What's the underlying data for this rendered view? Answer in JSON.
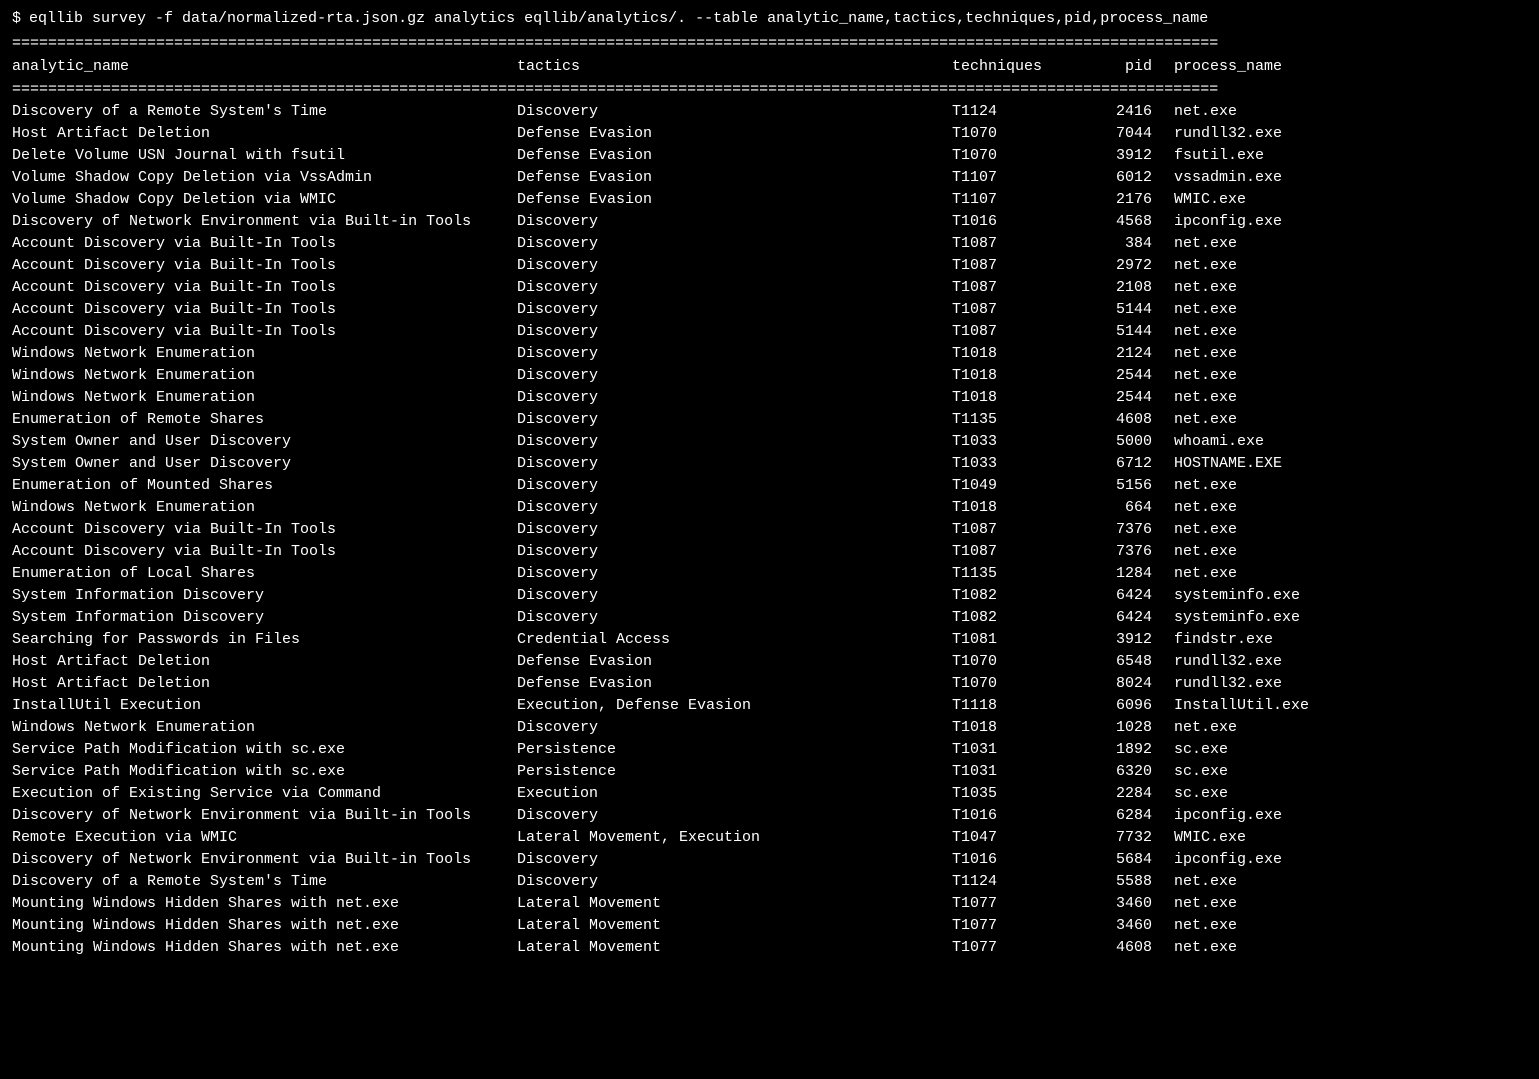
{
  "prompt": "$",
  "command": "eqllib survey -f data/normalized-rta.json.gz analytics eqllib/analytics/. --table analytic_name,tactics,techniques,pid,process_name",
  "divider": "======================================================================================================================================",
  "headers": {
    "analytic_name": "analytic_name",
    "tactics": "tactics",
    "techniques": "techniques",
    "pid": "pid",
    "process_name": "process_name"
  },
  "rows": [
    {
      "analytic_name": "Discovery of a Remote System's Time",
      "tactics": "Discovery",
      "techniques": "T1124",
      "pid": "2416",
      "process_name": "net.exe"
    },
    {
      "analytic_name": "Host Artifact Deletion",
      "tactics": "Defense Evasion",
      "techniques": "T1070",
      "pid": "7044",
      "process_name": "rundll32.exe"
    },
    {
      "analytic_name": "Delete Volume USN Journal with fsutil",
      "tactics": "Defense Evasion",
      "techniques": "T1070",
      "pid": "3912",
      "process_name": "fsutil.exe"
    },
    {
      "analytic_name": "Volume Shadow Copy Deletion via VssAdmin",
      "tactics": "Defense Evasion",
      "techniques": "T1107",
      "pid": "6012",
      "process_name": "vssadmin.exe"
    },
    {
      "analytic_name": "Volume Shadow Copy Deletion via WMIC",
      "tactics": "Defense Evasion",
      "techniques": "T1107",
      "pid": "2176",
      "process_name": "WMIC.exe"
    },
    {
      "analytic_name": "Discovery of Network Environment via Built-in Tools",
      "tactics": "Discovery",
      "techniques": "T1016",
      "pid": "4568",
      "process_name": "ipconfig.exe"
    },
    {
      "analytic_name": "Account Discovery via Built-In Tools",
      "tactics": "Discovery",
      "techniques": "T1087",
      "pid": "384",
      "process_name": "net.exe"
    },
    {
      "analytic_name": "Account Discovery via Built-In Tools",
      "tactics": "Discovery",
      "techniques": "T1087",
      "pid": "2972",
      "process_name": "net.exe"
    },
    {
      "analytic_name": "Account Discovery via Built-In Tools",
      "tactics": "Discovery",
      "techniques": "T1087",
      "pid": "2108",
      "process_name": "net.exe"
    },
    {
      "analytic_name": "Account Discovery via Built-In Tools",
      "tactics": "Discovery",
      "techniques": "T1087",
      "pid": "5144",
      "process_name": "net.exe"
    },
    {
      "analytic_name": "Account Discovery via Built-In Tools",
      "tactics": "Discovery",
      "techniques": "T1087",
      "pid": "5144",
      "process_name": "net.exe"
    },
    {
      "analytic_name": "Windows Network Enumeration",
      "tactics": "Discovery",
      "techniques": "T1018",
      "pid": "2124",
      "process_name": "net.exe"
    },
    {
      "analytic_name": "Windows Network Enumeration",
      "tactics": "Discovery",
      "techniques": "T1018",
      "pid": "2544",
      "process_name": "net.exe"
    },
    {
      "analytic_name": "Windows Network Enumeration",
      "tactics": "Discovery",
      "techniques": "T1018",
      "pid": "2544",
      "process_name": "net.exe"
    },
    {
      "analytic_name": "Enumeration of Remote Shares",
      "tactics": "Discovery",
      "techniques": "T1135",
      "pid": "4608",
      "process_name": "net.exe"
    },
    {
      "analytic_name": "System Owner and User Discovery",
      "tactics": "Discovery",
      "techniques": "T1033",
      "pid": "5000",
      "process_name": "whoami.exe"
    },
    {
      "analytic_name": "System Owner and User Discovery",
      "tactics": "Discovery",
      "techniques": "T1033",
      "pid": "6712",
      "process_name": "HOSTNAME.EXE"
    },
    {
      "analytic_name": "Enumeration of Mounted Shares",
      "tactics": "Discovery",
      "techniques": "T1049",
      "pid": "5156",
      "process_name": "net.exe"
    },
    {
      "analytic_name": "Windows Network Enumeration",
      "tactics": "Discovery",
      "techniques": "T1018",
      "pid": "664",
      "process_name": "net.exe"
    },
    {
      "analytic_name": "Account Discovery via Built-In Tools",
      "tactics": "Discovery",
      "techniques": "T1087",
      "pid": "7376",
      "process_name": "net.exe"
    },
    {
      "analytic_name": "Account Discovery via Built-In Tools",
      "tactics": "Discovery",
      "techniques": "T1087",
      "pid": "7376",
      "process_name": "net.exe"
    },
    {
      "analytic_name": "Enumeration of Local Shares",
      "tactics": "Discovery",
      "techniques": "T1135",
      "pid": "1284",
      "process_name": "net.exe"
    },
    {
      "analytic_name": "System Information Discovery",
      "tactics": "Discovery",
      "techniques": "T1082",
      "pid": "6424",
      "process_name": "systeminfo.exe"
    },
    {
      "analytic_name": "System Information Discovery",
      "tactics": "Discovery",
      "techniques": "T1082",
      "pid": "6424",
      "process_name": "systeminfo.exe"
    },
    {
      "analytic_name": "Searching for Passwords in Files",
      "tactics": "Credential Access",
      "techniques": "T1081",
      "pid": "3912",
      "process_name": "findstr.exe"
    },
    {
      "analytic_name": "Host Artifact Deletion",
      "tactics": "Defense Evasion",
      "techniques": "T1070",
      "pid": "6548",
      "process_name": "rundll32.exe"
    },
    {
      "analytic_name": "Host Artifact Deletion",
      "tactics": "Defense Evasion",
      "techniques": "T1070",
      "pid": "8024",
      "process_name": "rundll32.exe"
    },
    {
      "analytic_name": "InstallUtil Execution",
      "tactics": "Execution, Defense Evasion",
      "techniques": "T1118",
      "pid": "6096",
      "process_name": "InstallUtil.exe"
    },
    {
      "analytic_name": "Windows Network Enumeration",
      "tactics": "Discovery",
      "techniques": "T1018",
      "pid": "1028",
      "process_name": "net.exe"
    },
    {
      "analytic_name": "Service Path Modification with sc.exe",
      "tactics": "Persistence",
      "techniques": "T1031",
      "pid": "1892",
      "process_name": "sc.exe"
    },
    {
      "analytic_name": "Service Path Modification with sc.exe",
      "tactics": "Persistence",
      "techniques": "T1031",
      "pid": "6320",
      "process_name": "sc.exe"
    },
    {
      "analytic_name": "Execution of Existing Service via Command",
      "tactics": "Execution",
      "techniques": "T1035",
      "pid": "2284",
      "process_name": "sc.exe"
    },
    {
      "analytic_name": "Discovery of Network Environment via Built-in Tools",
      "tactics": "Discovery",
      "techniques": "T1016",
      "pid": "6284",
      "process_name": "ipconfig.exe"
    },
    {
      "analytic_name": "Remote Execution via WMIC",
      "tactics": "Lateral Movement, Execution",
      "techniques": "T1047",
      "pid": "7732",
      "process_name": "WMIC.exe"
    },
    {
      "analytic_name": "Discovery of Network Environment via Built-in Tools",
      "tactics": "Discovery",
      "techniques": "T1016",
      "pid": "5684",
      "process_name": "ipconfig.exe"
    },
    {
      "analytic_name": "Discovery of a Remote System's Time",
      "tactics": "Discovery",
      "techniques": "T1124",
      "pid": "5588",
      "process_name": "net.exe"
    },
    {
      "analytic_name": "Mounting Windows Hidden Shares with net.exe",
      "tactics": "Lateral Movement",
      "techniques": "T1077",
      "pid": "3460",
      "process_name": "net.exe"
    },
    {
      "analytic_name": "Mounting Windows Hidden Shares with net.exe",
      "tactics": "Lateral Movement",
      "techniques": "T1077",
      "pid": "3460",
      "process_name": "net.exe"
    },
    {
      "analytic_name": "Mounting Windows Hidden Shares with net.exe",
      "tactics": "Lateral Movement",
      "techniques": "T1077",
      "pid": "4608",
      "process_name": "net.exe"
    }
  ]
}
